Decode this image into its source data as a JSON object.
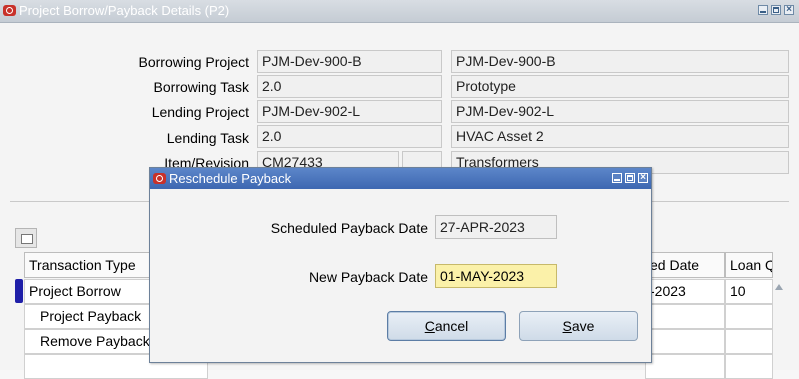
{
  "main_window": {
    "title": "Project Borrow/Payback Details (P2)",
    "fields": {
      "borrowing_project": {
        "label": "Borrowing Project",
        "value": "PJM-Dev-900-B",
        "desc": "PJM-Dev-900-B"
      },
      "borrowing_task": {
        "label": "Borrowing Task",
        "value": "2.0",
        "desc": "Prototype"
      },
      "lending_project": {
        "label": "Lending Project",
        "value": "PJM-Dev-902-L",
        "desc": "PJM-Dev-902-L"
      },
      "lending_task": {
        "label": "Lending Task",
        "value": "2.0",
        "desc": "HVAC Asset 2"
      },
      "item_revision": {
        "label": "Item/Revision",
        "value": "CM27433",
        "desc": "Transformers"
      }
    },
    "table": {
      "headers": [
        "Transaction Type",
        "ed Date",
        "Loan Q"
      ],
      "rows": [
        {
          "type": "Project Borrow",
          "date": "-2023",
          "qty": "10"
        },
        {
          "type": "Project Payback",
          "date": "",
          "qty": ""
        },
        {
          "type": "Remove Payback",
          "date": "",
          "qty": ""
        }
      ]
    }
  },
  "dialog": {
    "title": "Reschedule Payback",
    "scheduled_label": "Scheduled Payback Date",
    "scheduled_value": "27-APR-2023",
    "new_label": "New Payback Date",
    "new_value": "01-MAY-2023",
    "cancel_first": "C",
    "cancel_rest": "ancel",
    "save_first": "S",
    "save_rest": "ave"
  },
  "colors": {
    "dialog_title_bg": "#4a74bd",
    "editable_field_bg": "#fbf1a9",
    "row_indicator": "#1f1fa8"
  }
}
